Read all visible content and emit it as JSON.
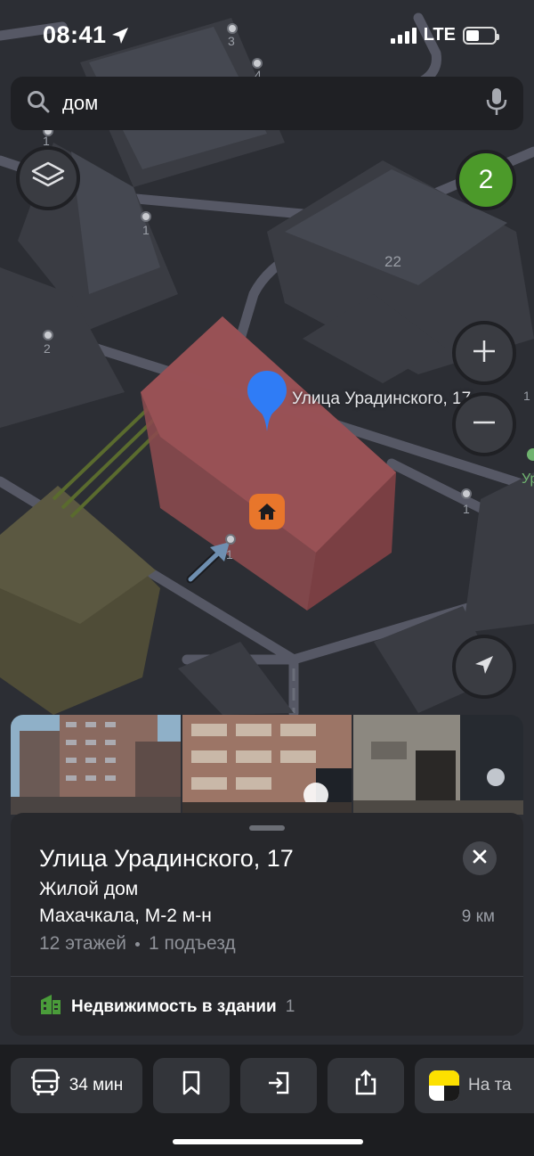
{
  "status_bar": {
    "time": "08:41",
    "network": "LTE"
  },
  "search": {
    "query": "дом"
  },
  "map": {
    "labels": [
      "3",
      "4",
      "1",
      "1",
      "22",
      "2",
      "1",
      "1",
      "1",
      "1"
    ],
    "place_label": "Улица Урадинского, 17",
    "edge_label_right": "Ур",
    "results_count": "2"
  },
  "card": {
    "title": "Улица Урадинского, 17",
    "type": "Жилой дом",
    "address": "Махачкала, М-2 м-н",
    "distance": "9 км",
    "floors": "12 этажей",
    "entrances": "1 подъезд",
    "real_estate_label": "Недвижимость в здании",
    "real_estate_count": "1"
  },
  "bottom_bar": {
    "route_label": "34 мин",
    "taxi_label": "На та"
  },
  "colors": {
    "accent_green": "#4c9a2a",
    "pin_blue": "#2f7cf6",
    "building_highlight": "#8a4a4e",
    "home_marker": "#e8762b"
  },
  "icons": [
    "location-arrow-icon",
    "search-icon",
    "microphone-icon",
    "layers-icon",
    "plus-icon",
    "minus-icon",
    "compass-arrow-icon",
    "close-icon",
    "bus-icon",
    "bookmark-icon",
    "route-icon",
    "share-icon",
    "yandex-go-icon",
    "building-icon",
    "home-icon",
    "pin-icon"
  ]
}
